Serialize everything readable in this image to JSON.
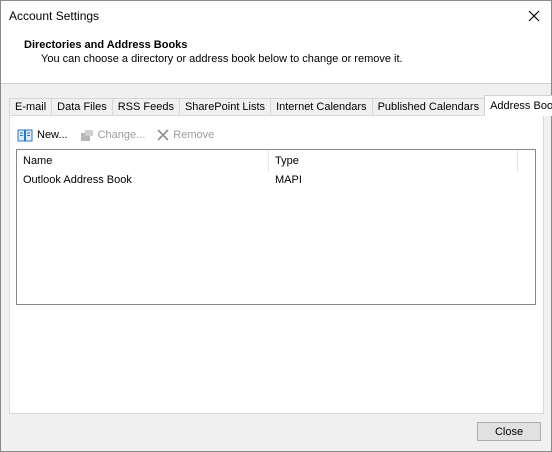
{
  "window": {
    "title": "Account Settings"
  },
  "header": {
    "title": "Directories and Address Books",
    "subtitle": "You can choose a directory or address book below to change or remove it."
  },
  "tabs": [
    {
      "label": "E-mail"
    },
    {
      "label": "Data Files"
    },
    {
      "label": "RSS Feeds"
    },
    {
      "label": "SharePoint Lists"
    },
    {
      "label": "Internet Calendars"
    },
    {
      "label": "Published Calendars"
    },
    {
      "label": "Address Books",
      "active": true
    }
  ],
  "toolbar": {
    "new_label": "New...",
    "change_label": "Change...",
    "remove_label": "Remove"
  },
  "list": {
    "columns": [
      "Name",
      "Type"
    ],
    "rows": [
      {
        "name": "Outlook Address Book",
        "type": "MAPI"
      }
    ]
  },
  "footer": {
    "close_label": "Close"
  },
  "colors": {
    "accent_book": "#2b78c2",
    "disabled_text": "#9c9c9c"
  }
}
